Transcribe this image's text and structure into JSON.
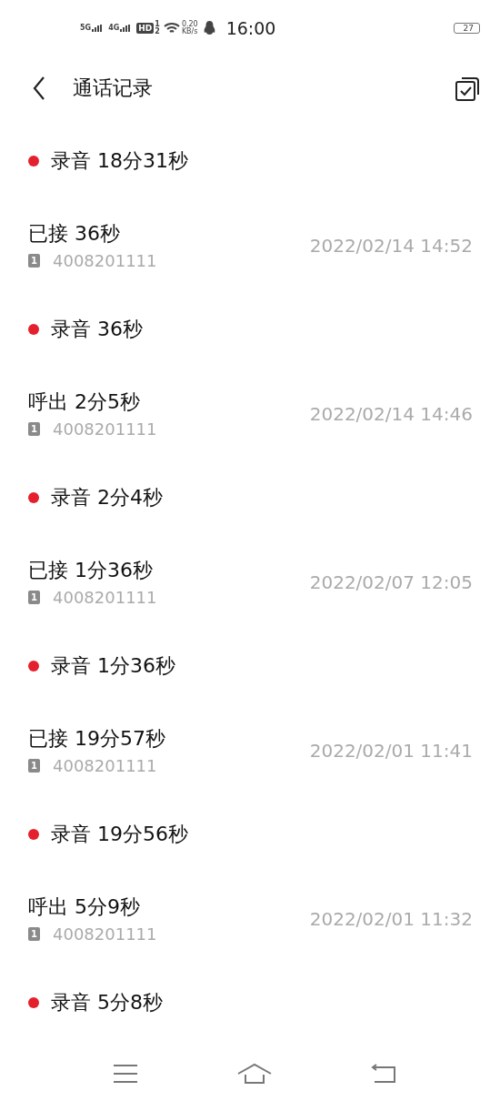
{
  "status_bar": {
    "networks": [
      "5G",
      "4G"
    ],
    "hd": "HD",
    "sim_slots": [
      "1",
      "2"
    ],
    "speed": "0.20",
    "speed_unit": "KB/s",
    "time": "16:00",
    "battery": "27"
  },
  "header": {
    "title": "通话记录"
  },
  "records": [
    {
      "kind": "recording",
      "label": "录音 18分31秒"
    },
    {
      "kind": "call",
      "label": "已接 36秒",
      "sim": "1",
      "number": "4008201111",
      "time": "2022/02/14 14:52"
    },
    {
      "kind": "recording",
      "label": "录音 36秒"
    },
    {
      "kind": "call",
      "label": "呼出 2分5秒",
      "sim": "1",
      "number": "4008201111",
      "time": "2022/02/14 14:46"
    },
    {
      "kind": "recording",
      "label": "录音 2分4秒"
    },
    {
      "kind": "call",
      "label": "已接 1分36秒",
      "sim": "1",
      "number": "4008201111",
      "time": "2022/02/07 12:05"
    },
    {
      "kind": "recording",
      "label": "录音 1分36秒"
    },
    {
      "kind": "call",
      "label": "已接 19分57秒",
      "sim": "1",
      "number": "4008201111",
      "time": "2022/02/01 11:41"
    },
    {
      "kind": "recording",
      "label": "录音 19分56秒"
    },
    {
      "kind": "call",
      "label": "呼出 5分9秒",
      "sim": "1",
      "number": "4008201111",
      "time": "2022/02/01 11:32"
    },
    {
      "kind": "recording",
      "label": "录音 5分8秒"
    }
  ]
}
